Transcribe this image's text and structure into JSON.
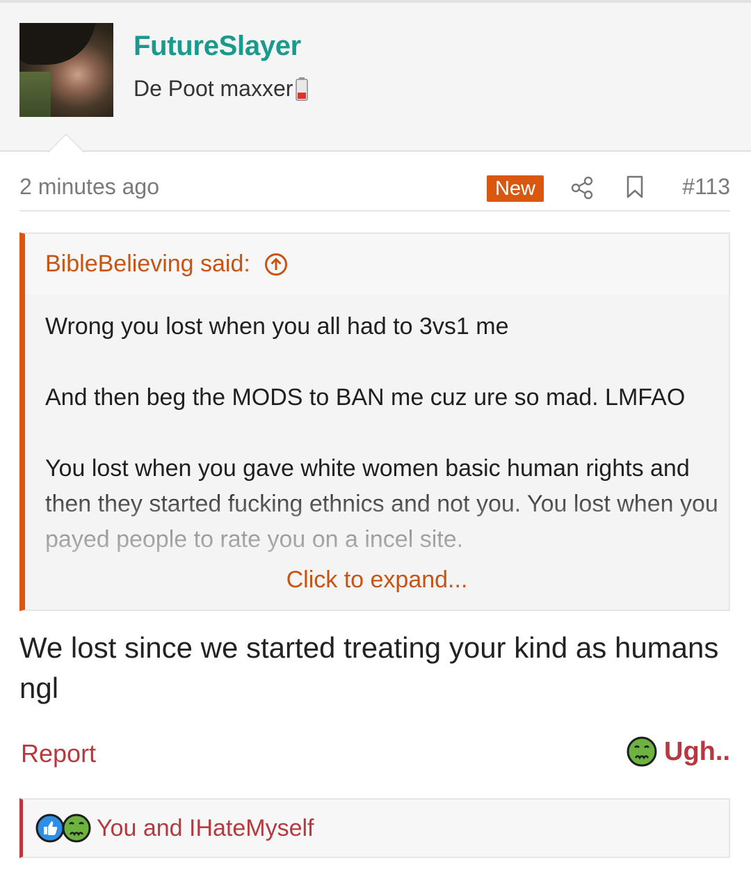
{
  "user": {
    "name": "FutureSlayer",
    "title": "De Poot maxxer",
    "title_icon": "battery-low-icon"
  },
  "post": {
    "time": "2 minutes ago",
    "badge": "New",
    "number": "#113"
  },
  "quote": {
    "author_line": "BibleBelieving said:",
    "paragraphs": [
      "Wrong you lost when you all had to 3vs1 me",
      "And then beg the MODS to BAN me cuz ure so mad. LMFAO",
      "You lost when you gave white women basic human rights and then they started fucking ethnics and not you. You lost when you payed people to rate you on a incel site."
    ],
    "expand_label": "Click to expand..."
  },
  "reply_text": "We lost since we started treating your kind as humans ngl",
  "actions": {
    "report": "Report",
    "reaction": "Ugh.."
  },
  "reactions_summary": {
    "icons": [
      "like-icon",
      "nauseated-face-icon"
    ],
    "text": "You and IHateMyself"
  },
  "colors": {
    "username": "#1a9a8c",
    "accent_orange": "#d9570e",
    "accent_red": "#b5393f"
  }
}
